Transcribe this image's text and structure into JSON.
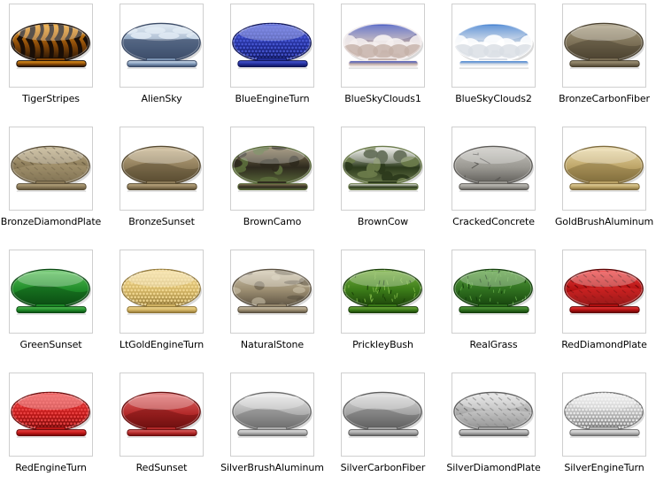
{
  "grid": {
    "items": [
      {
        "label": "TigerStripes",
        "pattern": "stripes",
        "colors": [
          "#f0a020",
          "#8a4a08",
          "#1a0e06"
        ]
      },
      {
        "label": "AlienSky",
        "pattern": "sky",
        "colors": [
          "#d9e6f2",
          "#7c95b5",
          "#3a4a66"
        ]
      },
      {
        "label": "BlueEngineTurn",
        "pattern": "dots",
        "colors": [
          "#4a5ad8",
          "#232f9a",
          "#0e1456"
        ]
      },
      {
        "label": "BlueSkyClouds1",
        "pattern": "clouds",
        "colors": [
          "#2a40b8",
          "#c4b0a8",
          "#f4eeee"
        ]
      },
      {
        "label": "BlueSkyClouds2",
        "pattern": "clouds",
        "colors": [
          "#1e68c8",
          "#d8dde4",
          "#ffffff"
        ]
      },
      {
        "label": "BronzeCarbonFiber",
        "pattern": "wave",
        "colors": [
          "#a59a7c",
          "#7a6e55",
          "#4a412f"
        ]
      },
      {
        "label": "BronzeDiamondPlate",
        "pattern": "plate",
        "colors": [
          "#bfae86",
          "#8a7a58",
          "#5a4e36"
        ]
      },
      {
        "label": "BronzeSunset",
        "pattern": "wave",
        "colors": [
          "#c4b088",
          "#8e7c5a",
          "#56492f"
        ]
      },
      {
        "label": "BrownCamo",
        "pattern": "camo",
        "colors": [
          "#8a7a58",
          "#2e2a1e",
          "#5a6a3a"
        ]
      },
      {
        "label": "BrownCow",
        "pattern": "cow",
        "colors": [
          "#f4f4f0",
          "#2c3a1c",
          "#6a7a4a"
        ]
      },
      {
        "label": "CrackedConcrete",
        "pattern": "cracked",
        "colors": [
          "#c8c6c0",
          "#9a9892",
          "#5c5a56"
        ]
      },
      {
        "label": "GoldBrushAluminum",
        "pattern": "wave",
        "colors": [
          "#e8d7a4",
          "#bda568",
          "#7e6a3a"
        ]
      },
      {
        "label": "GreenSunset",
        "pattern": "wave",
        "colors": [
          "#58c058",
          "#1e8a28",
          "#0a4a12"
        ]
      },
      {
        "label": "LtGoldEngineTurn",
        "pattern": "dots",
        "colors": [
          "#f4dc98",
          "#d2b464",
          "#8e7434"
        ]
      },
      {
        "label": "NaturalStone",
        "pattern": "stone",
        "colors": [
          "#d2c8b0",
          "#9a8c70",
          "#5a5040"
        ]
      },
      {
        "label": "PrickleyBush",
        "pattern": "grass",
        "colors": [
          "#78b040",
          "#3a7a18",
          "#1a4008"
        ]
      },
      {
        "label": "RealGrass",
        "pattern": "grass",
        "colors": [
          "#5aa040",
          "#2e6e1e",
          "#14400c"
        ]
      },
      {
        "label": "RedDiamondPlate",
        "pattern": "plate",
        "colors": [
          "#f04040",
          "#b01010",
          "#600404"
        ]
      },
      {
        "label": "RedEngineTurn",
        "pattern": "dots",
        "colors": [
          "#f04848",
          "#c01818",
          "#680808"
        ]
      },
      {
        "label": "RedSunset",
        "pattern": "wave",
        "colors": [
          "#e06a6a",
          "#b42a2a",
          "#6a0e0e"
        ]
      },
      {
        "label": "SilverBrushAluminum",
        "pattern": "wave",
        "colors": [
          "#e8e8e8",
          "#b0b0b0",
          "#6a6a6a"
        ]
      },
      {
        "label": "SilverCarbonFiber",
        "pattern": "wave",
        "colors": [
          "#d8d8d8",
          "#a4a4a4",
          "#5c5c5c"
        ]
      },
      {
        "label": "SilverDiamondPlate",
        "pattern": "plate",
        "colors": [
          "#e4e4e4",
          "#a8a8a8",
          "#5e5e5e"
        ]
      },
      {
        "label": "SilverEngineTurn",
        "pattern": "dots",
        "colors": [
          "#f0f0f0",
          "#b8b8b8",
          "#707070"
        ]
      }
    ]
  }
}
